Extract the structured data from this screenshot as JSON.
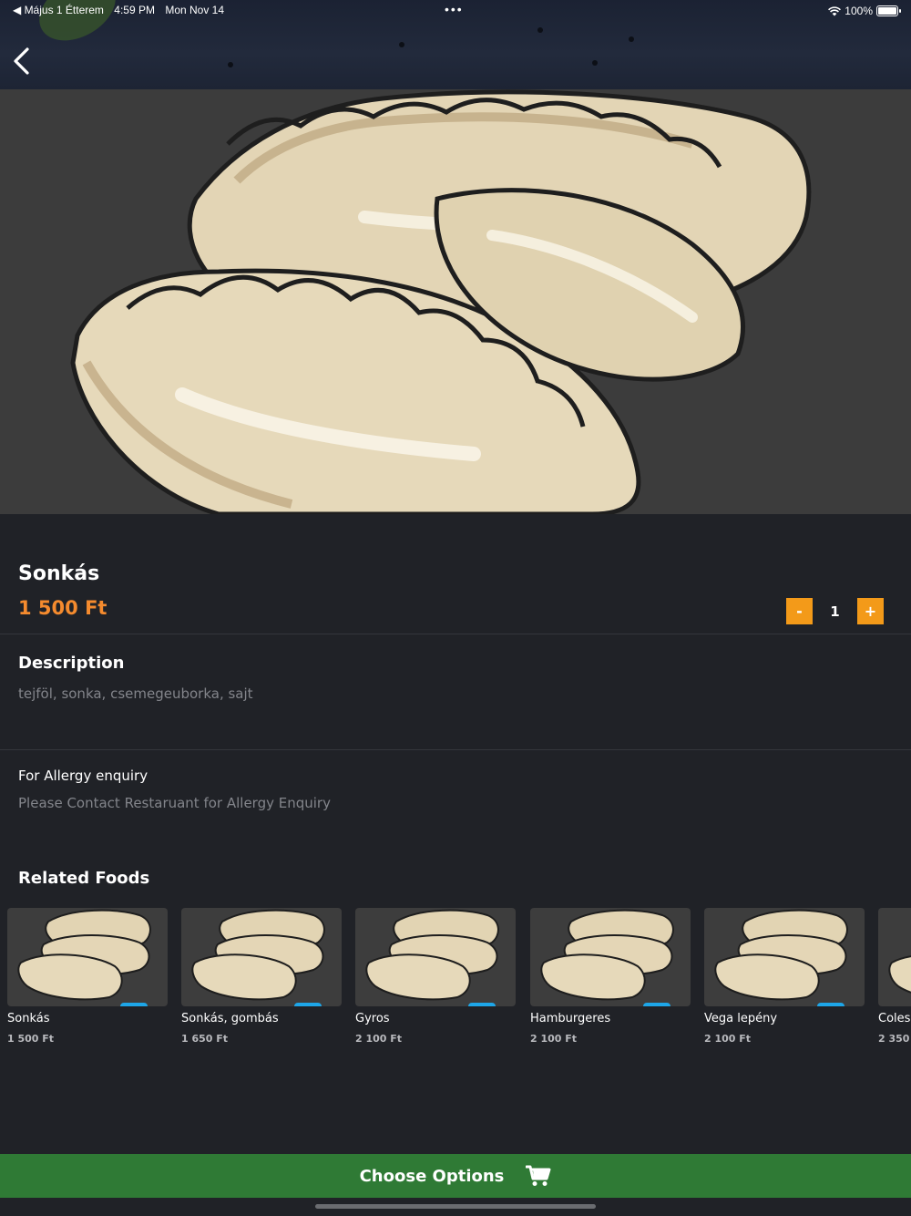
{
  "status_bar": {
    "back_app": "◀ Május 1 Étterem",
    "time": "4:59 PM",
    "date": "Mon Nov 14",
    "dots": "•••",
    "battery": "100%"
  },
  "product": {
    "name": "Sonkás",
    "price": "1 500 Ft",
    "quantity": "1",
    "minus_label": "-",
    "plus_label": "+"
  },
  "description": {
    "heading": "Description",
    "text": "tejföl, sonka, csemegeuborka, sajt"
  },
  "allergy": {
    "heading": "For Allergy enquiry",
    "text": "Please Contact Restaruant for Allergy Enquiry"
  },
  "related": {
    "heading": "Related Foods",
    "items": [
      {
        "name": "Sonkás",
        "price": "1 500 Ft"
      },
      {
        "name": "Sonkás, gombás",
        "price": "1 650 Ft"
      },
      {
        "name": "Gyros",
        "price": "2 100 Ft"
      },
      {
        "name": "Hamburgeres",
        "price": "2 100 Ft"
      },
      {
        "name": "Vega lepény",
        "price": "2 100 Ft"
      },
      {
        "name": "Coles",
        "price": "2 350"
      }
    ]
  },
  "cta": {
    "label": "Choose Options",
    "icon": "cart-icon"
  },
  "colors": {
    "accent_price": "#f58b2e",
    "qty_button": "#f39a19",
    "cta": "#2f7a35",
    "background": "#202227"
  }
}
